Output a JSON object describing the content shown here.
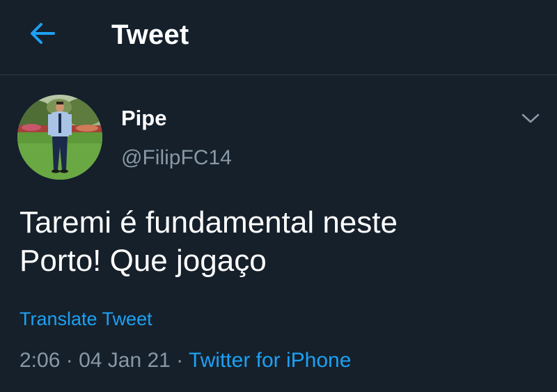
{
  "colors": {
    "background": "#15202b",
    "accent": "#1da1f2",
    "secondary_text": "#8899a6",
    "divider": "#2f3b47"
  },
  "header": {
    "back_icon": "arrow-left-icon",
    "title": "Tweet"
  },
  "author": {
    "avatar_icon": "profile-photo",
    "display_name": "Pipe",
    "handle": "@FilipFC14",
    "more_icon": "chevron-down-icon"
  },
  "tweet": {
    "text_line1": "Taremi é fundamental neste",
    "text_line2": "Porto! Que jogaço",
    "translate_label": "Translate Tweet",
    "time": "2:06",
    "separator": " · ",
    "date": "04 Jan 21",
    "source": "Twitter for iPhone"
  }
}
